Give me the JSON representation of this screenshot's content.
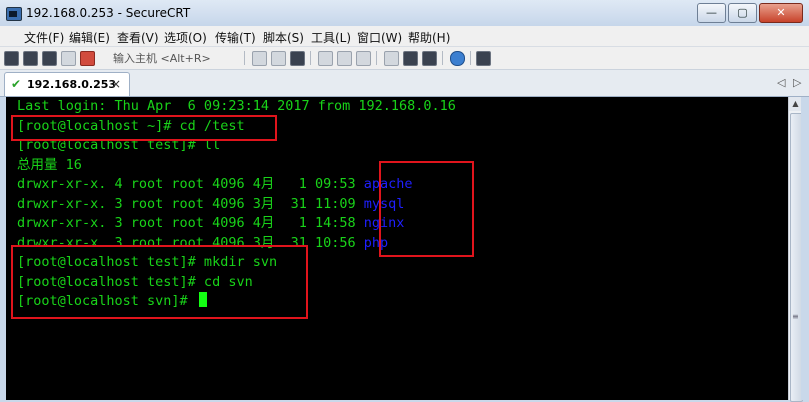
{
  "window": {
    "title": "192.168.0.253 - SecureCRT"
  },
  "menu": [
    "文件(F)",
    "编辑(E)",
    "查看(V)",
    "选项(O)",
    "传输(T)",
    "脚本(S)",
    "工具(L)",
    "窗口(W)",
    "帮助(H)"
  ],
  "toolbar": {
    "connect_placeholder": "输入主机 <Alt+R>",
    "icons": [
      "connect-icon",
      "quick-connect-icon",
      "connect-tab-icon",
      "reconnect-icon",
      "disconnect-icon",
      "copy-icon",
      "paste-icon",
      "find-icon",
      "print-icon",
      "print-setup-icon",
      "log-icon",
      "options-icon",
      "settings-icon",
      "keymap-icon",
      "help-icon",
      "sftp-icon"
    ]
  },
  "tab": {
    "label": "192.168.0.253",
    "close": "×",
    "status_icon": "✔"
  },
  "tab_nav": {
    "left": "◁",
    "right": "▷"
  },
  "terminal": {
    "lines": [
      {
        "text": "Last login: Thu Apr  6 09:23:14 2017 from 192.168.0.16"
      },
      {
        "text": "[root@localhost ~]# cd /test"
      },
      {
        "text": "[root@localhost test]# ll"
      },
      {
        "text": "总用量 16"
      },
      {
        "text": "drwxr-xr-x. 4 root root 4096 4月   1 09:53 ",
        "name": "apache"
      },
      {
        "text": "drwxr-xr-x. 3 root root 4096 3月  31 11:09 ",
        "name": "mysql"
      },
      {
        "text": "drwxr-xr-x. 3 root root 4096 4月   1 14:58 ",
        "name": "nginx"
      },
      {
        "text": "drwxr-xr-x. 3 root root 4096 3月  31 10:56 ",
        "name": "php"
      },
      {
        "text": "[root@localhost test]# mkdir svn"
      },
      {
        "text": "[root@localhost test]# cd svn"
      },
      {
        "text": "[root@localhost svn]# "
      }
    ]
  },
  "colors": {
    "terminal_bg": "#000000",
    "terminal_fg": "#19d319",
    "dir_name": "#1f1fff",
    "highlight_box": "#e0141c",
    "cursor": "#13ff13"
  }
}
